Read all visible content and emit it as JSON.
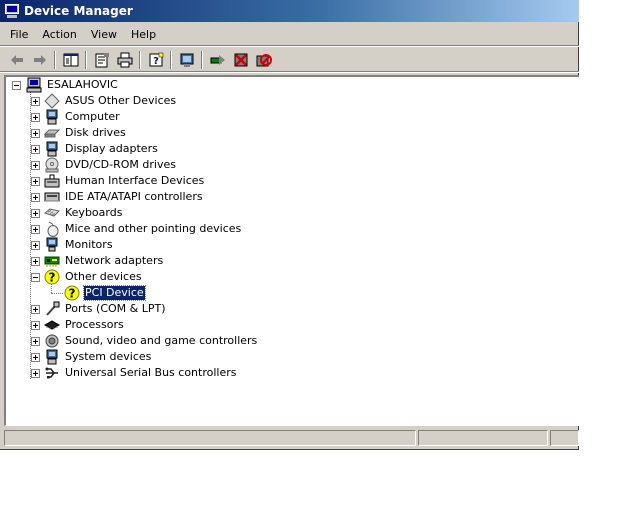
{
  "window": {
    "title": "Device Manager"
  },
  "menu": {
    "file": "File",
    "action": "Action",
    "view": "View",
    "help": "Help"
  },
  "toolbar": {
    "buttons": [
      "back-icon",
      "forward-icon",
      "show-hide-tree-icon",
      "properties-icon",
      "print-icon",
      "help-icon",
      "scan-hardware-icon",
      "update-driver-icon",
      "uninstall-icon",
      "disable-icon"
    ]
  },
  "tree": {
    "root": "ESALAHOVIC",
    "items": [
      {
        "label": "ASUS Other Devices",
        "icon": "other-devices-icon"
      },
      {
        "label": "Computer",
        "icon": "computer-icon"
      },
      {
        "label": "Disk drives",
        "icon": "disk-drive-icon"
      },
      {
        "label": "Display adapters",
        "icon": "display-adapter-icon"
      },
      {
        "label": "DVD/CD-ROM drives",
        "icon": "cdrom-icon"
      },
      {
        "label": "Human Interface Devices",
        "icon": "hid-icon"
      },
      {
        "label": "IDE ATA/ATAPI controllers",
        "icon": "ide-controller-icon"
      },
      {
        "label": "Keyboards",
        "icon": "keyboard-icon"
      },
      {
        "label": "Mice and other pointing devices",
        "icon": "mouse-icon"
      },
      {
        "label": "Monitors",
        "icon": "monitor-icon"
      },
      {
        "label": "Network adapters",
        "icon": "network-adapter-icon"
      },
      {
        "label": "Other devices",
        "icon": "unknown-device-icon"
      },
      {
        "label": "Ports (COM & LPT)",
        "icon": "port-icon"
      },
      {
        "label": "Processors",
        "icon": "processor-icon"
      },
      {
        "label": "Sound, video and game controllers",
        "icon": "sound-icon"
      },
      {
        "label": "System devices",
        "icon": "system-device-icon"
      },
      {
        "label": "Universal Serial Bus controllers",
        "icon": "usb-icon"
      }
    ],
    "child": {
      "label": "PCI Device",
      "icon": "warning-device-icon"
    }
  },
  "colors": {
    "title_start": "#0a246a",
    "title_end": "#a6caf0",
    "selection": "#0a246a",
    "chrome": "#d4d0c8"
  }
}
